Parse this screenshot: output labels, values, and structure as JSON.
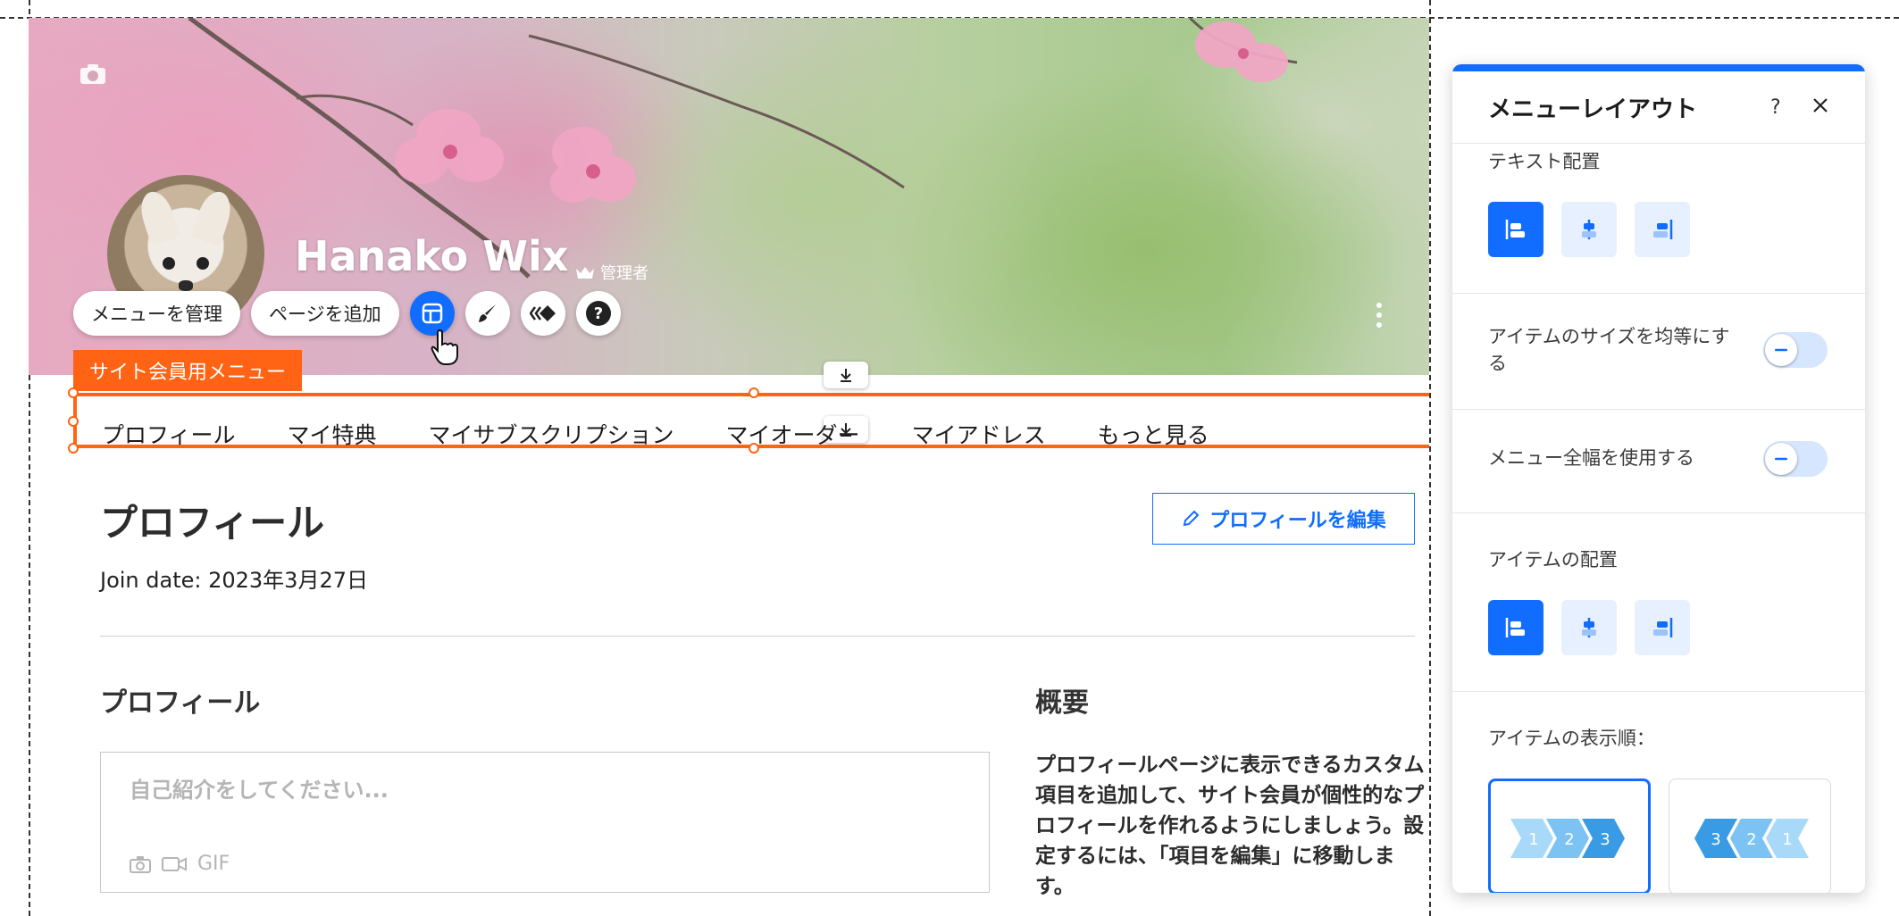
{
  "profile": {
    "name": "Hanako Wix",
    "role": "管理者"
  },
  "toolbar": {
    "manage_menu": "メニューを管理",
    "add_page": "ページを追加"
  },
  "menu_tag": "サイト会員用メニュー",
  "menu_items": [
    "プロフィール",
    "マイ特典",
    "マイサブスクリプション",
    "マイオーダー",
    "マイアドレス",
    "もっと見る"
  ],
  "page": {
    "title": "プロフィール",
    "join_date": "Join date: 2023年3月27日",
    "edit_button": "プロフィールを編集",
    "bio_title": "プロフィール",
    "bio_placeholder": "自己紹介をしてください...",
    "media_gif": "GIF",
    "about_title": "概要",
    "about_text": "プロフィールページに表示できるカスタム項目を追加して、サイト会員が個性的なプロフィールを作れるようにしましょう。設定するには、「項目を編集」に移動します。"
  },
  "panel": {
    "title": "メニューレイアウト",
    "help": "?",
    "text_alignment_label": "テキスト配置",
    "equal_size_label": "アイテムのサイズを均等にする",
    "full_width_label": "メニュー全幅を使用する",
    "item_alignment_label": "アイテムの配置",
    "item_order_label": "アイテムの表示順：",
    "order_ltr": [
      "1",
      "2",
      "3"
    ],
    "order_rtl": [
      "3",
      "2",
      "1"
    ],
    "toggles": {
      "equal_size": false,
      "full_width": false
    }
  },
  "colors": {
    "accent": "#116dff",
    "selection": "#ff6313"
  },
  "icons": [
    "camera-icon",
    "crown-icon",
    "more-vertical-icon",
    "layout-icon",
    "paint-brush-icon",
    "animation-icon",
    "help-icon",
    "download-icon",
    "pencil-icon",
    "close-icon",
    "video-icon"
  ]
}
